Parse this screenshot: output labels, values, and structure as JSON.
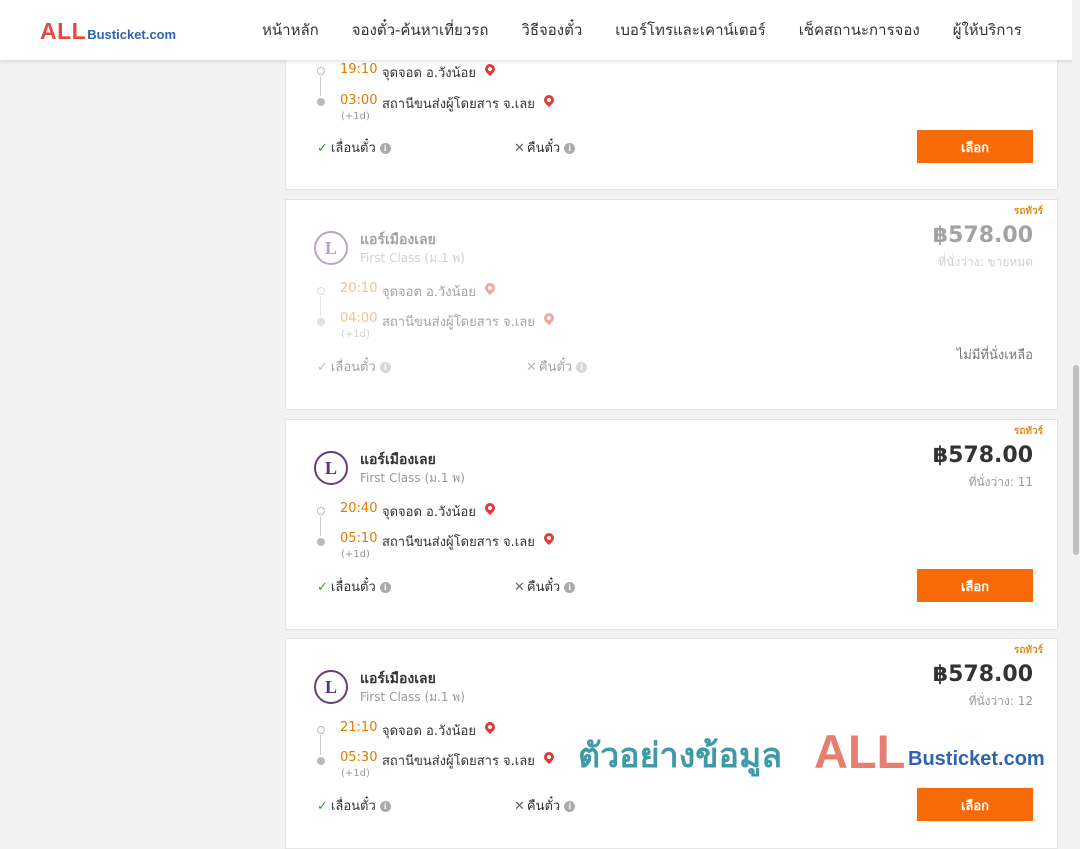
{
  "header": {
    "logo_all": "ALL",
    "logo_rest": "Busticket.com",
    "nav": [
      "หน้าหลัก",
      "จองตั๋ว-ค้นหาเที่ยวรถ",
      "วิธีจองตั๋ว",
      "เบอร์โทรและเคาน์เตอร์",
      "เช็คสถานะการจอง",
      "ผู้ให้บริการ"
    ]
  },
  "cards": [
    {
      "depart_time": "19:10",
      "depart_place": "จุดจอด อ.วังน้อย",
      "arrive_time": "03:00",
      "arrive_place": "สถานีขนส่งผู้โดยสาร จ.เลย",
      "plus_day": "(+1d)",
      "reschedule": "เลื่อนตั๋ว",
      "refund": "คืนตั๋ว",
      "button": "เลือก"
    },
    {
      "badge": "รถทัวร์",
      "operator": "แอร์เมืองเลย",
      "class": "First Class (ม.1 พ)",
      "price": "฿578.00",
      "seats": "ที่นั่งว่าง: ขายหมด",
      "depart_time": "20:10",
      "depart_place": "จุดจอด อ.วังน้อย",
      "arrive_time": "04:00",
      "arrive_place": "สถานีขนส่งผู้โดยสาร จ.เลย",
      "plus_day": "(+1d)",
      "reschedule": "เลื่อนตั๋ว",
      "refund": "คืนตั๋ว",
      "status": "ไม่มีที่นั่งเหลือ"
    },
    {
      "badge": "รถทัวร์",
      "operator": "แอร์เมืองเลย",
      "class": "First Class (ม.1 พ)",
      "price": "฿578.00",
      "seats": "ที่นั่งว่าง: 11",
      "depart_time": "20:40",
      "depart_place": "จุดจอด อ.วังน้อย",
      "arrive_time": "05:10",
      "arrive_place": "สถานีขนส่งผู้โดยสาร จ.เลย",
      "plus_day": "(+1d)",
      "reschedule": "เลื่อนตั๋ว",
      "refund": "คืนตั๋ว",
      "button": "เลือก"
    },
    {
      "badge": "รถทัวร์",
      "operator": "แอร์เมืองเลย",
      "class": "First Class (ม.1 พ)",
      "price": "฿578.00",
      "seats": "ที่นั่งว่าง: 12",
      "depart_time": "21:10",
      "depart_place": "จุดจอด อ.วังน้อย",
      "arrive_time": "05:30",
      "arrive_place": "สถานีขนส่งผู้โดยสาร จ.เลย",
      "plus_day": "(+1d)",
      "reschedule": "เลื่อนตั๋ว",
      "refund": "คืนตั๋ว",
      "button": "เลือก"
    }
  ],
  "watermark": {
    "thai": "ตัวอย่างข้อมูล",
    "all": "ALL",
    "rest": "Busticket.com"
  }
}
